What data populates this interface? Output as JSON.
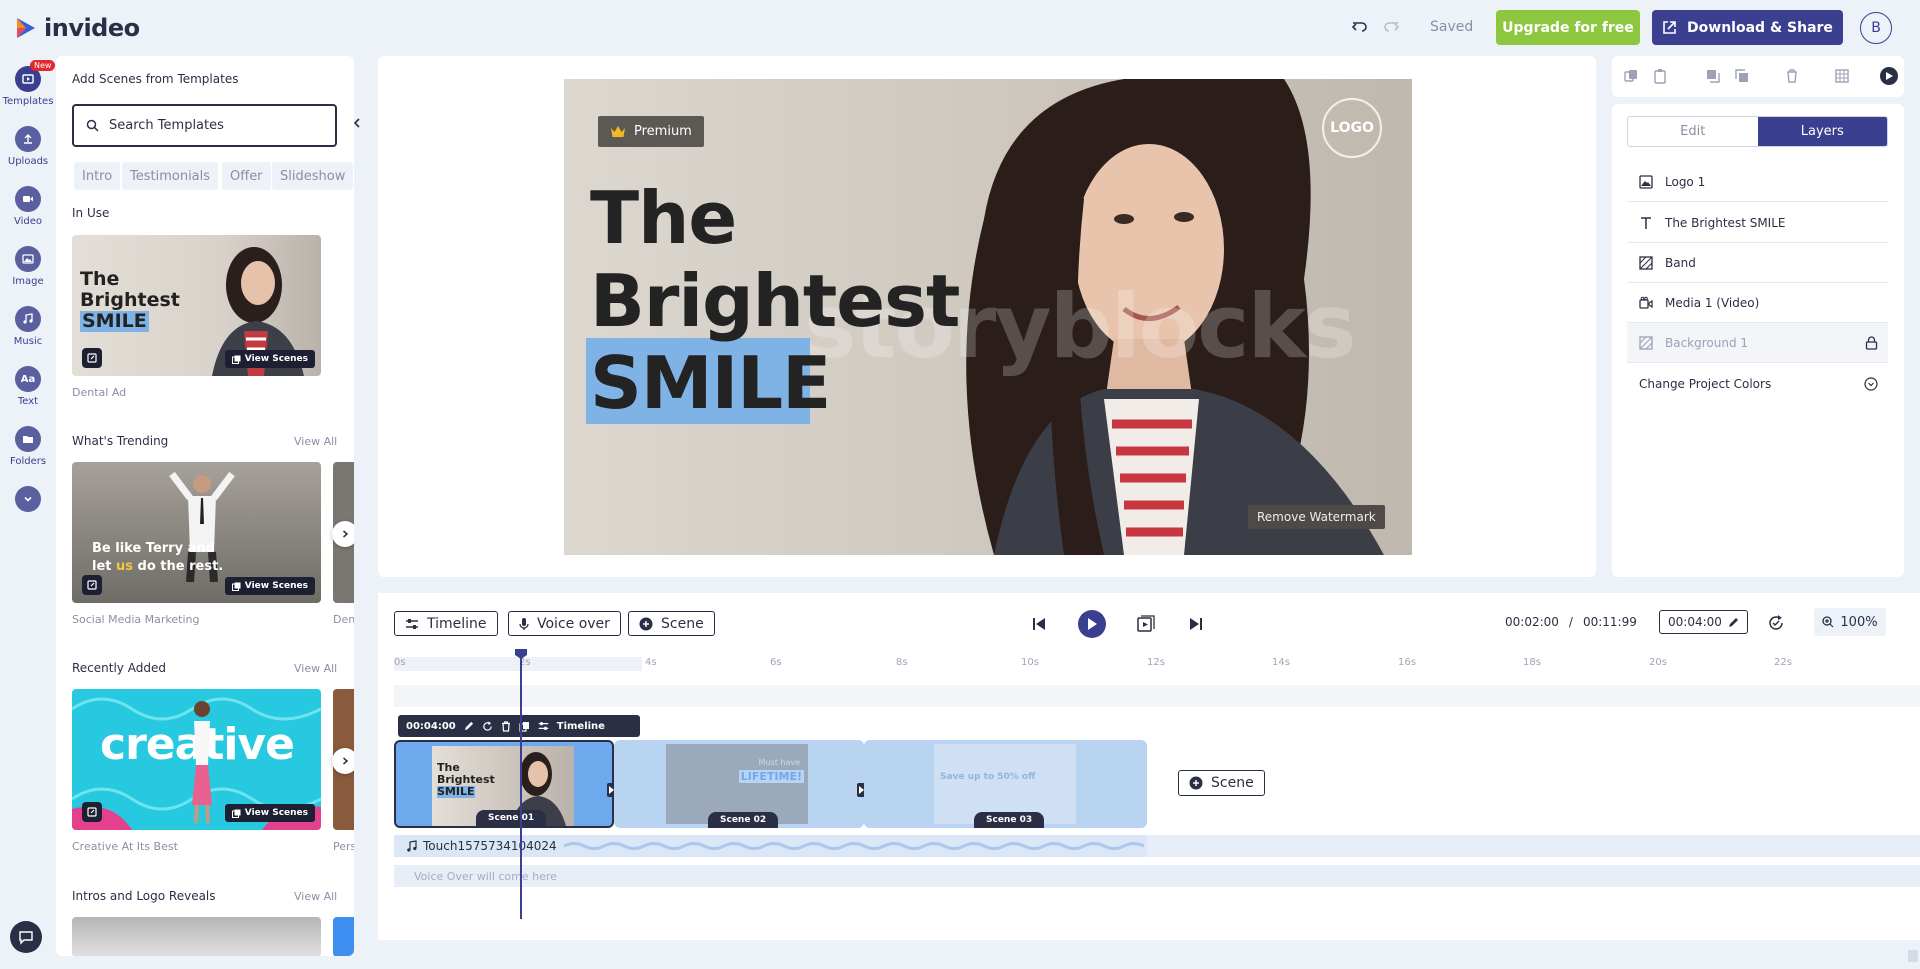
{
  "app": {
    "name": "invideo"
  },
  "header": {
    "saved": "Saved",
    "upgrade_label": "Upgrade for free",
    "download_label": "Download & Share",
    "avatar_initial": "B"
  },
  "rail": {
    "new_badge": "New",
    "items": [
      "Templates",
      "Uploads",
      "Video",
      "Image",
      "Music",
      "Text",
      "Folders"
    ]
  },
  "panel": {
    "title": "Add Scenes from Templates",
    "search_placeholder": "Search Templates",
    "chips": [
      "Intro",
      "Testimonials",
      "Offer",
      "Slideshow"
    ],
    "in_use": "In Use",
    "in_use_caption": "Dental Ad",
    "in_use_thumb_text": [
      "The",
      "Brightest",
      "SMILE"
    ],
    "view_scenes": "View Scenes",
    "trending": "What's Trending",
    "view_all": "View All",
    "trending_caption_1": "Social Media Marketing",
    "trending_caption_2": "Dent",
    "trending_thumb_text": "Be like Terry and let us do the rest.",
    "trending_thumb_line1": "Be like Terry and",
    "trending_thumb_line2a": "let ",
    "trending_thumb_line2b": "us",
    "trending_thumb_line2c": " do the rest.",
    "recent": "Recently Added",
    "recent_caption_1": "Creative At Its Best",
    "recent_caption_2": "Pers",
    "recent_thumb_text": "creative",
    "intros": "Intros and Logo Reveals"
  },
  "canvas": {
    "premium": "Premium",
    "logo": "LOGO",
    "line1": "The",
    "line2": "Brightest",
    "line3": "SMILE",
    "watermark": "storyblocks",
    "remove_watermark": "Remove Watermark"
  },
  "right": {
    "tab_edit": "Edit",
    "tab_layers": "Layers",
    "layers": [
      "Logo 1",
      "The Brightest SMILE",
      "Band",
      "Media 1 (Video)",
      "Background 1"
    ],
    "change_colors": "Change Project Colors"
  },
  "timeline": {
    "timeline_btn": "Timeline",
    "voice_btn": "Voice over",
    "scene_btn": "Scene",
    "current_time": "00:02:00",
    "separator": "/",
    "total_time": "00:11:99",
    "scene_duration": "00:04:00",
    "zoom": "100%",
    "ruler": [
      "0s",
      "2s",
      "4s",
      "6s",
      "8s",
      "10s",
      "12s",
      "14s",
      "16s",
      "18s",
      "20s",
      "22s"
    ],
    "scene_toolbar_time": "00:04:00",
    "scene_toolbar_timeline": "Timeline",
    "scenes": [
      "Scene 01",
      "Scene 02",
      "Scene 03"
    ],
    "add_scene": "Scene",
    "scene2_text1": "Must have",
    "scene2_text2": "LIFETIME!",
    "scene3_text": "Save up to 50% off",
    "audio_track": "Touch1575734104024",
    "voice_placeholder": "Voice Over will come here"
  }
}
